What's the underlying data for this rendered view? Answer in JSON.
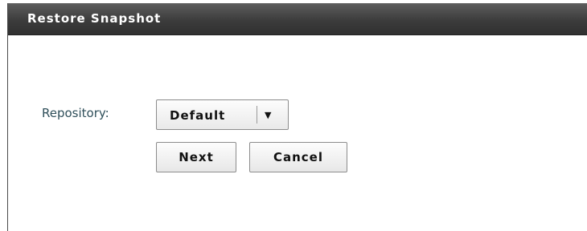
{
  "dialog": {
    "title": "Restore Snapshot"
  },
  "form": {
    "repository_label": "Repository:",
    "repository_value": "Default",
    "dropdown_icon": "chevron-down-icon"
  },
  "buttons": {
    "next_label": "Next",
    "cancel_label": "Cancel"
  }
}
